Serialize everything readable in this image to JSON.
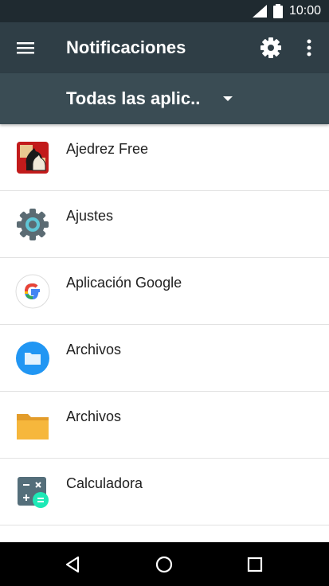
{
  "status_bar": {
    "time": "10:00"
  },
  "toolbar": {
    "title": "Notificaciones"
  },
  "filter": {
    "selected": "Todas las aplic.."
  },
  "apps": [
    {
      "name": "Ajedrez Free",
      "icon": "chess-knight-icon"
    },
    {
      "name": "Ajustes",
      "icon": "settings-gear-icon"
    },
    {
      "name": "Aplicación Google",
      "icon": "google-g-icon"
    },
    {
      "name": "Archivos",
      "icon": "files-folder-icon"
    },
    {
      "name": "Archivos",
      "icon": "orange-folder-icon"
    },
    {
      "name": "Calculadora",
      "icon": "calculator-icon"
    }
  ],
  "colors": {
    "status_bar": "#1f2a30",
    "toolbar": "#2f3e46",
    "filter_bar": "#3a4c54",
    "nav_bar": "#000000"
  }
}
